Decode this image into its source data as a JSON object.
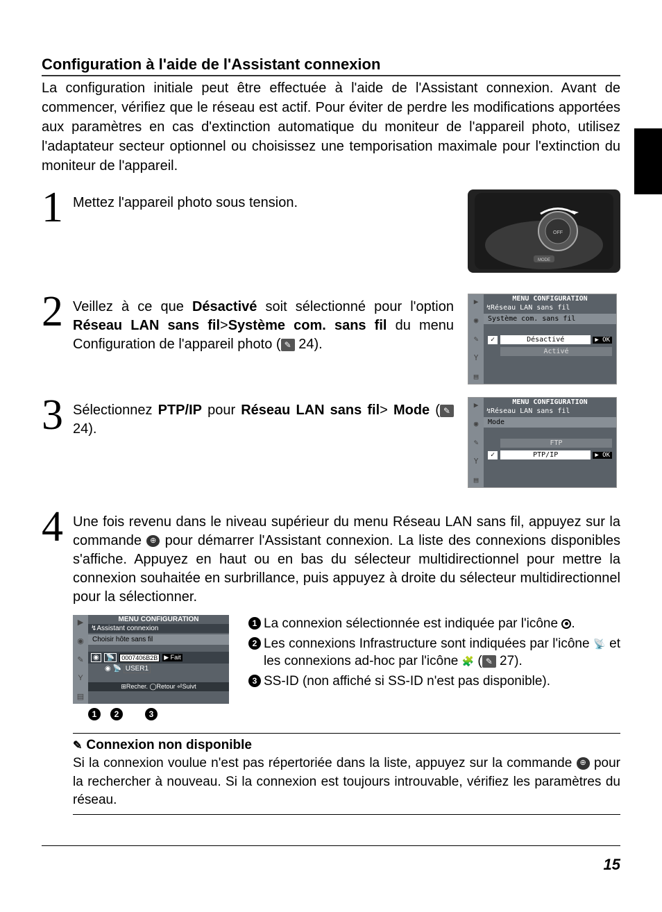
{
  "title": "Configuration à l'aide de l'Assistant connexion",
  "intro": "La configuration initiale peut être effectuée à l'aide de l'Assistant connexion. Avant de commencer, vérifiez que le réseau est actif. Pour éviter de perdre les modifications apportées aux paramètres en cas d'extinction automatique du moniteur de l'appareil photo, utilisez l'adaptateur secteur optionnel ou choisissez une temporisation maximale pour l'extinction du moniteur de l'appareil.",
  "steps": {
    "s1": {
      "num": "1",
      "text": "Mettez l'appareil photo sous tension."
    },
    "s2": {
      "num": "2",
      "pre1": "Veillez à ce que ",
      "bold1": "Désactivé",
      "mid1": " soit sélectionné pour l'option ",
      "bold2": "Réseau LAN sans fil",
      "gt": ">",
      "bold3": "Système com. sans fil",
      "mid2": " du menu Configuration de l'appareil photo (",
      "pref": "24",
      "end": ")."
    },
    "s3": {
      "num": "3",
      "pre": "Sélectionnez ",
      "bold1": "PTP/IP",
      "mid": " pour ",
      "bold2": "Réseau LAN sans fil",
      "gt": ">",
      "bold3": "Mode",
      "paren_open": " (",
      "pref": "24",
      "end": ")."
    },
    "s4": {
      "num": "4",
      "text_a": "Une fois revenu dans le niveau supérieur du menu Réseau LAN sans fil, appuyez sur la commande ",
      "text_b": " pour démarrer l'Assistant connexion. La liste des connexions disponibles s'affiche. Appuyez en haut ou en bas du sélecteur multidirectionnel pour mettre la connexion souhaitée en surbrillance, puis appuyez à droite du sélecteur multidirectionnel pour la sélectionner.",
      "annot1": "La connexion sélectionnée est indiquée par l'icône ",
      "annot1_end": ".",
      "annot2_a": "Les connexions Infrastructure sont indiquées par l'icône ",
      "annot2_b": " et les connexions ad-hoc par l'icône ",
      "annot2_c": " (",
      "annot2_ref": "27",
      "annot2_end": ").",
      "annot3": "SS-ID (non affiché si SS-ID n'est pas disponible)."
    }
  },
  "screens": {
    "screen1": {
      "title": "MENU CONFIGURATION",
      "sub": "↯Réseau LAN sans fil",
      "line": "Système com. sans fil",
      "opt1": "Désactivé",
      "opt2": "Activé",
      "ok": "▶ OK"
    },
    "screen2": {
      "title": "MENU CONFIGURATION",
      "sub": "↯Réseau LAN sans fil",
      "line": "Mode",
      "opt1": "FTP",
      "opt2": "PTP/IP",
      "ok": "▶ OK"
    },
    "screen3": {
      "title": "MENU CONFIGURATION",
      "sub": "↯Assistant connexion",
      "line": "Choisir hôte sans fil",
      "ssid": "0007406B2B",
      "fait": "▶ Fait",
      "user": "USER1",
      "footer": "⊞Recher. ◯Retour ⏎Suivt"
    }
  },
  "badges": {
    "b1": "1",
    "b2": "2",
    "b3": "3"
  },
  "note": {
    "title": "Connexion non disponible",
    "body_a": "Si la connexion voulue n'est pas répertoriée dans la liste, appuyez sur la commande ",
    "body_b": " pour la rechercher à nouveau. Si la connexion est toujours introuvable, vérifiez les paramètres du réseau."
  },
  "page_number": "15"
}
